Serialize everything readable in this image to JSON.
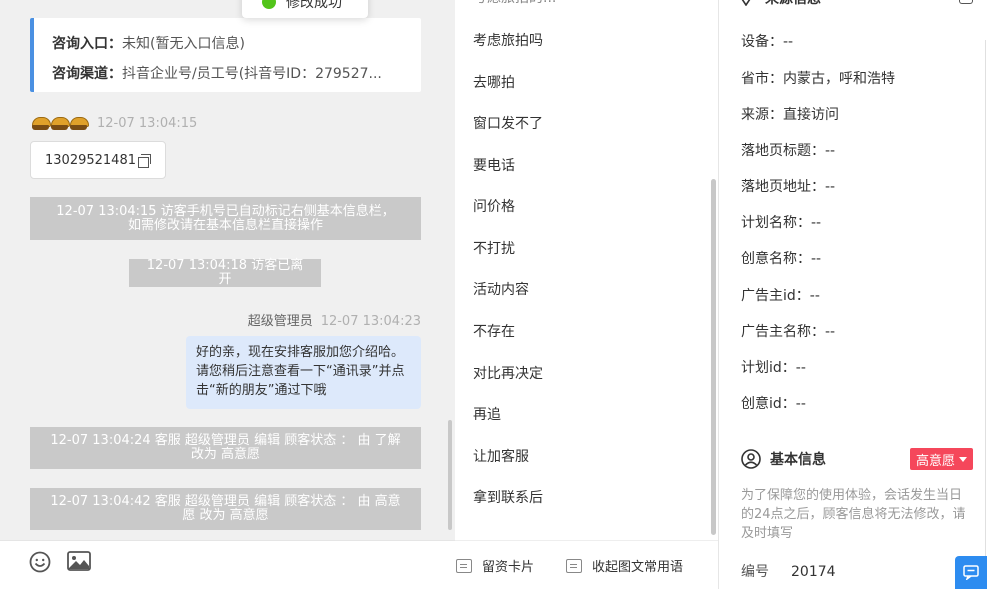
{
  "toast": {
    "text": "修改成功"
  },
  "consult": {
    "entry_label": "咨询入口：",
    "entry_value": "未知(暂无入口信息)",
    "channel_label": "咨询渠道：",
    "channel_value": "抖音企业号/员工号(抖音号ID：279527..."
  },
  "messages": {
    "visitor_time": "12-07 13:04:15",
    "phone": "13029521481",
    "sys1_line1": "12-07 13:04:15 访客手机号已自动标记右侧基本信息栏，",
    "sys1_line2": "如需修改请在基本信息栏直接操作",
    "sys2": "12-07 13:04:18 访客已离开",
    "agent_name": "超级管理员",
    "agent_time": "12-07 13:04:23",
    "agent_text": "好的亲，现在安排客服加您介绍哈。请您稍后注意查看一下“通讯录”并点击“新的朋友”通过下哦",
    "sys3_line1": "12-07 13:04:24 客服 超级管理员 编辑 顾客状态 ： 由 了解",
    "sys3_line2": "改为 高意愿",
    "sys4_line1": "12-07 13:04:42 客服 超级管理员 编辑 顾客状态 ： 由 高意",
    "sys4_line2": "愿 改为 高意愿"
  },
  "phrases": {
    "items": [
      "考虑旅拍吗",
      "去哪拍",
      "窗口发不了",
      "要电话",
      "问价格",
      "不打扰",
      "活动内容",
      "不存在",
      "对比再决定",
      "再追",
      "让加客服",
      "拿到联系后"
    ],
    "card_button": "留资卡片",
    "collapse_button": "收起图文常用语"
  },
  "source_info": {
    "title": "来源信息",
    "rows": [
      "设备：--",
      "省市：内蒙古，呼和浩特",
      "来源：直接访问",
      "落地页标题：--",
      "落地页地址：--",
      "计划名称：--",
      "创意名称：--",
      "广告主id：--",
      "广告主名称：--",
      "计划id：--",
      "创意id：--"
    ]
  },
  "basic_info": {
    "title": "基本信息",
    "intent_badge": "高意愿",
    "notice": "为了保障您的使用体验，会话发生当日的24点之后，顾客信息将无法修改，请及时填写",
    "serial_label": "编号",
    "serial_value": "20174"
  },
  "colors": {
    "accent_blue": "#4a90e2",
    "badge_red": "#f5475b",
    "agent_bubble": "#dde9fb",
    "system_gray": "#c9c9c9"
  }
}
